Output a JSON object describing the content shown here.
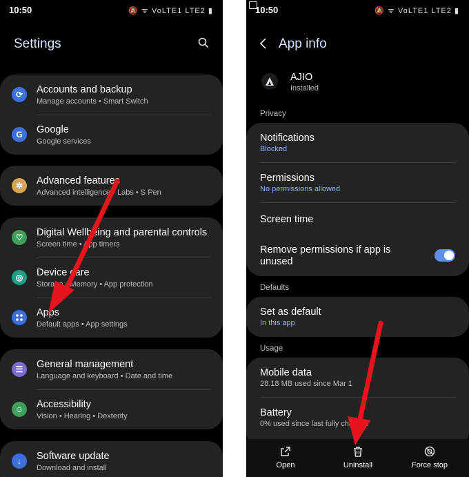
{
  "left": {
    "time": "10:50",
    "status_icons": "🔕 ᯤ VoLTE1 LTE2 ▮",
    "title": "Settings",
    "search_icon": "search-icon",
    "items": [
      {
        "title": "Accounts and backup",
        "sub": "Manage accounts  •  Smart Switch",
        "color": "#3d6fde",
        "icon": "sync-icon"
      },
      {
        "title": "Google",
        "sub": "Google services",
        "color": "#3d6fde",
        "icon": "google-icon"
      },
      {
        "title": "Advanced features",
        "sub": "Advanced intelligence  •  Labs  •  S Pen",
        "color": "#d9a452",
        "icon": "gear-plus-icon"
      },
      {
        "title": "Digital Wellbeing and parental controls",
        "sub": "Screen time  •  App timers",
        "color": "#3ea05a",
        "icon": "wellbeing-icon"
      },
      {
        "title": "Device care",
        "sub": "Storage  •  Memory  •  App protection",
        "color": "#1f9e85",
        "icon": "device-care-icon"
      },
      {
        "title": "Apps",
        "sub": "Default apps  •  App settings",
        "color": "#3d6fde",
        "icon": "apps-icon"
      },
      {
        "title": "General management",
        "sub": "Language and keyboard  •  Date and time",
        "color": "#7c6cd6",
        "icon": "sliders-icon"
      },
      {
        "title": "Accessibility",
        "sub": "Vision  •  Hearing  •  Dexterity",
        "color": "#3ea05a",
        "icon": "accessibility-icon"
      },
      {
        "title": "Software update",
        "sub": "Download and install",
        "color": "#3d6fde",
        "icon": "update-icon"
      }
    ]
  },
  "right": {
    "time": "10:50",
    "status_icons": "🔕 ᯤ VoLTE1 LTE2 ▮",
    "back_icon": "back-arrow-icon",
    "title": "App info",
    "app_name": "AJIO",
    "app_status": "Installed",
    "sections": {
      "privacy": "Privacy",
      "defaults": "Defaults",
      "usage": "Usage"
    },
    "privacy_items": [
      {
        "title": "Notifications",
        "sub": "Blocked"
      },
      {
        "title": "Permissions",
        "sub": "No permissions allowed"
      },
      {
        "title": "Screen time",
        "sub": ""
      },
      {
        "title": "Remove permissions if app is unused",
        "sub": "",
        "toggle": true
      }
    ],
    "defaults_items": [
      {
        "title": "Set as default",
        "sub": "In this app"
      }
    ],
    "usage_items": [
      {
        "title": "Mobile data",
        "sub": "28.18 MB used since Mar 1"
      },
      {
        "title": "Battery",
        "sub": "0% used since last fully charged"
      }
    ],
    "bottom": {
      "open": "Open",
      "uninstall": "Uninstall",
      "force_stop": "Force stop"
    }
  },
  "colors": {
    "accent_blue": "#8fb4ff",
    "arrow_red": "#e8141d",
    "toggle_on": "#5d8ee8"
  }
}
